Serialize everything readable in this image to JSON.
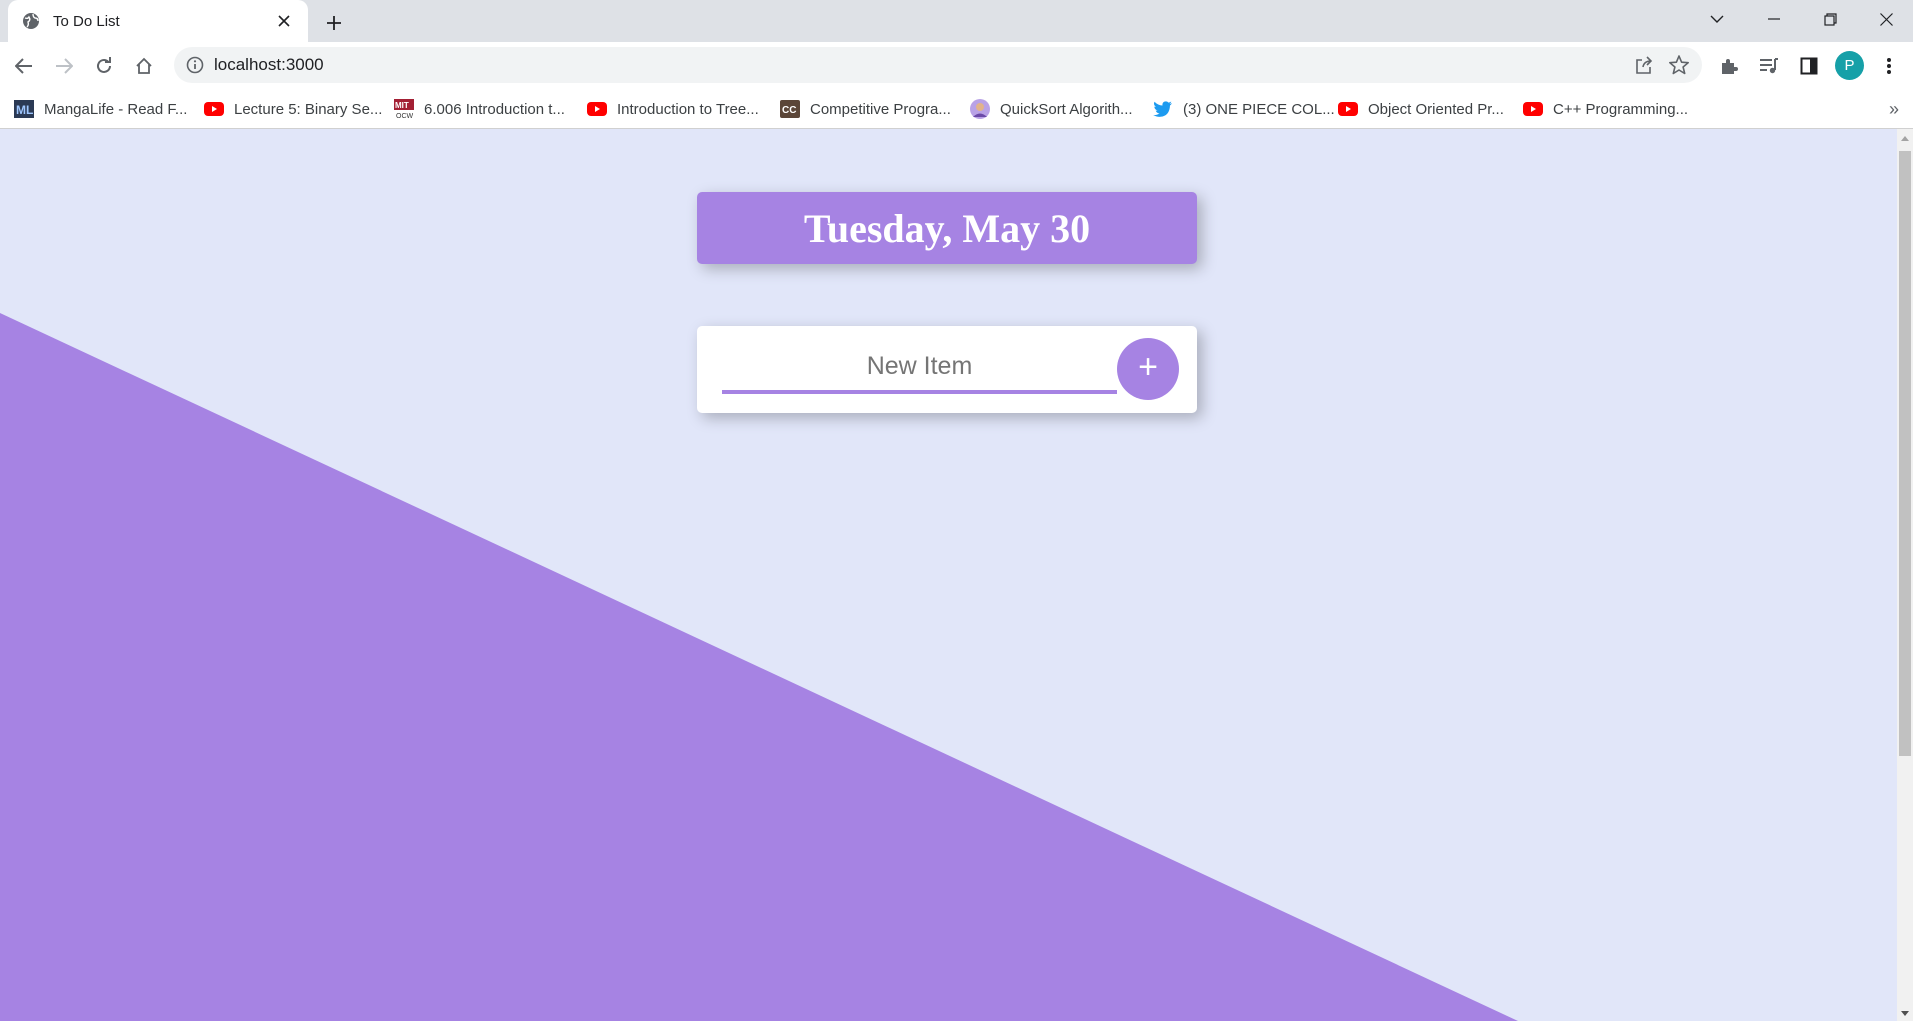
{
  "browser": {
    "tab": {
      "title": "To Do List",
      "favicon": "globe-icon"
    },
    "address_bar": {
      "url": "localhost:3000"
    },
    "profile_initial": "P",
    "bookmarks": [
      {
        "label": "MangaLife - Read F...",
        "icon": "mangalife-icon"
      },
      {
        "label": "Lecture 5: Binary Se...",
        "icon": "youtube-icon"
      },
      {
        "label": "6.006 Introduction t...",
        "icon": "mit-ocw-icon"
      },
      {
        "label": "Introduction to Tree...",
        "icon": "youtube-icon"
      },
      {
        "label": "Competitive Progra...",
        "icon": "codechef-icon"
      },
      {
        "label": "QuickSort Algorith...",
        "icon": "avatar-icon"
      },
      {
        "label": "(3) ONE PIECE COL...",
        "icon": "twitter-icon"
      },
      {
        "label": "Object Oriented Pr...",
        "icon": "youtube-icon"
      },
      {
        "label": "C++ Programming...",
        "icon": "youtube-icon"
      }
    ],
    "bookmarks_overflow": "»"
  },
  "page": {
    "heading": "Tuesday, May 30",
    "new_item_placeholder": "New Item",
    "add_button_label": "+"
  },
  "colors": {
    "accent": "#a683e3",
    "page_background": "#e1e6f9"
  }
}
